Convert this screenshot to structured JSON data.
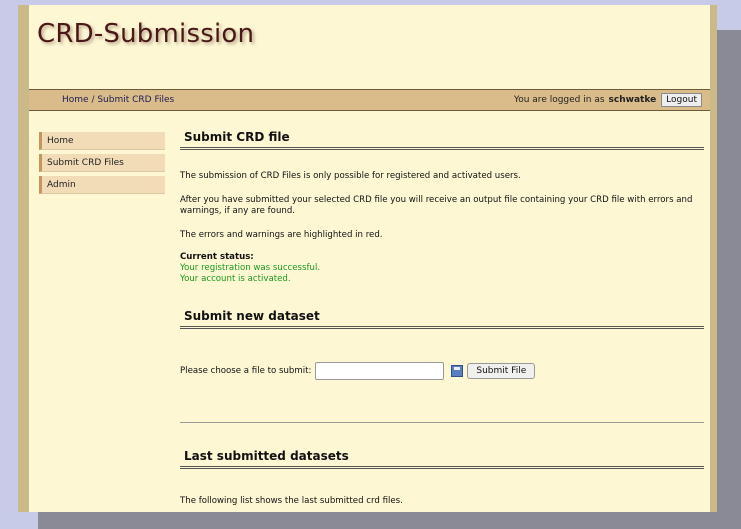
{
  "app": {
    "title": "CRD-Submission"
  },
  "navbar": {
    "breadcrumb": "Home / Submit CRD Files",
    "logged_in_text": "You are logged in as",
    "username": "schwatke",
    "logout_label": "Logout"
  },
  "sidebar": {
    "items": [
      {
        "label": "Home"
      },
      {
        "label": "Submit CRD Files"
      },
      {
        "label": "Admin"
      }
    ]
  },
  "main": {
    "section1_title": "Submit CRD file",
    "intro": "The submission of CRD Files is only possible for registered and activated users.",
    "after_submit": "After you have submitted your selected CRD file you will receive an output file containing your CRD file with errors and warnings, if any are found.",
    "highlight_note": "The errors and warnings are highlighted in red.",
    "status_label": "Current status:",
    "status_registration": "Your registration was successful.",
    "status_activation": "Your account is activated.",
    "section2_title": "Submit new dataset",
    "choose_file_label": "Please choose a file to submit:",
    "file_input_value": "",
    "submit_label": "Submit File",
    "section3_title": "Last submitted datasets",
    "list_intro": "The following list shows the last submitted crd files."
  },
  "colors": {
    "background": "#fdf7d4",
    "nav": "#d9bc8a",
    "status_green": "#1a9a1a",
    "logo": "#4a1818"
  },
  "icons": {
    "file_icon": "save-icon"
  }
}
